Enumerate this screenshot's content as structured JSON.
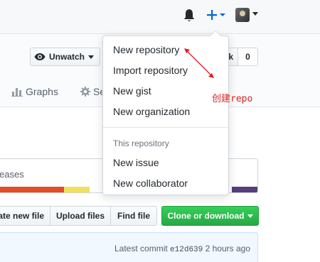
{
  "header": {
    "icons": [
      "bell-icon",
      "plus-icon",
      "avatar",
      "chevron-down-icon"
    ]
  },
  "repo_actions": {
    "unwatch_label": "Unwatch",
    "partial_label": "k",
    "count": "0"
  },
  "tabs": [
    {
      "label": "Graphs",
      "icon": "graph-icon"
    },
    {
      "label": "Se",
      "icon": "gear-icon"
    }
  ],
  "summary": {
    "releases_label": "eases",
    "language_colors": [
      "#e34c26",
      "#f1e05a",
      "#ffffff",
      "#563d7c"
    ],
    "language_fractions": [
      0.25,
      0.1,
      0.55,
      0.1
    ]
  },
  "file_actions": {
    "create_label": "ate new file",
    "upload_label": "Upload files",
    "find_label": "Find file",
    "clone_label": "Clone or download"
  },
  "commit": {
    "prefix": "Latest commit",
    "sha": "e12d639",
    "time": "2 hours ago"
  },
  "dropdown": {
    "items": [
      "New repository",
      "Import repository",
      "New gist",
      "New organization"
    ],
    "section_header": "This repository",
    "repo_items": [
      "New issue",
      "New collaborator"
    ]
  },
  "annotation": {
    "text": "创建repo",
    "color": "#e02020"
  },
  "colors": {
    "accent_blue": "#0366d6",
    "clone_green": "#28a745"
  }
}
